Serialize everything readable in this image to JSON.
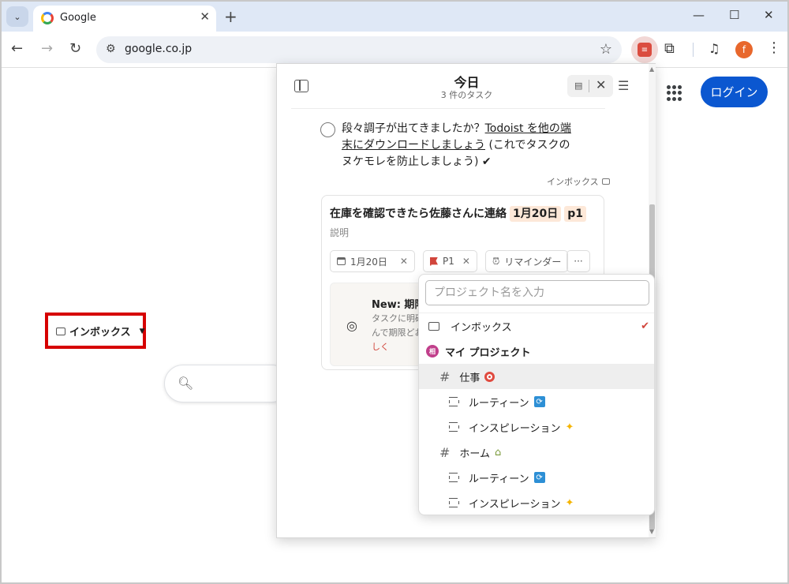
{
  "browser": {
    "tab_title": "Google",
    "url": "google.co.jp",
    "profile_initial": "f"
  },
  "google": {
    "login_label": "ログイン"
  },
  "popup": {
    "title": "今日",
    "subtitle": "3 件のタスク",
    "task": {
      "text_before": "段々調子が出てきましたか？",
      "link_text": "Todoist を他の端末にダウンロードしましょう",
      "text_after": " (これでタスクのヌケモレを防止しましょう) ✔",
      "project": "インボックス"
    },
    "editor": {
      "title_text": "在庫を確認できたら佐藤さんに連絡",
      "title_date": "1月20日",
      "title_priority": "p1",
      "description_placeholder": "説明",
      "date_chip": "1月20日",
      "priority_chip": "P1",
      "reminder_chip": "リマインダー",
      "more_label": "···",
      "promo_title": "New: 期限",
      "promo_line1": "タスクに明確",
      "promo_line2": "んで期限どお",
      "promo_line3": "しく"
    },
    "project_button": "インボックス"
  },
  "project_dropdown": {
    "placeholder": "プロジェクト名を入力",
    "items": [
      {
        "label": "インボックス",
        "type": "inbox",
        "selected": true
      },
      {
        "label": "マイ プロジェクト",
        "type": "workspace",
        "badge": "相"
      },
      {
        "label": "仕事",
        "type": "project",
        "emoji": "target"
      },
      {
        "label": "ルーティーン",
        "type": "section",
        "emoji": "repeat"
      },
      {
        "label": "インスピレーション",
        "type": "section",
        "emoji": "sparkles"
      },
      {
        "label": "ホーム",
        "type": "project",
        "emoji": "house"
      },
      {
        "label": "ルーティーン",
        "type": "section",
        "emoji": "repeat"
      },
      {
        "label": "インスピレーション",
        "type": "section",
        "emoji": "sparkles"
      }
    ]
  },
  "colors": {
    "accent": "#d1453b",
    "login_blue": "#0b57d0",
    "highlight_box": "#d60000"
  }
}
